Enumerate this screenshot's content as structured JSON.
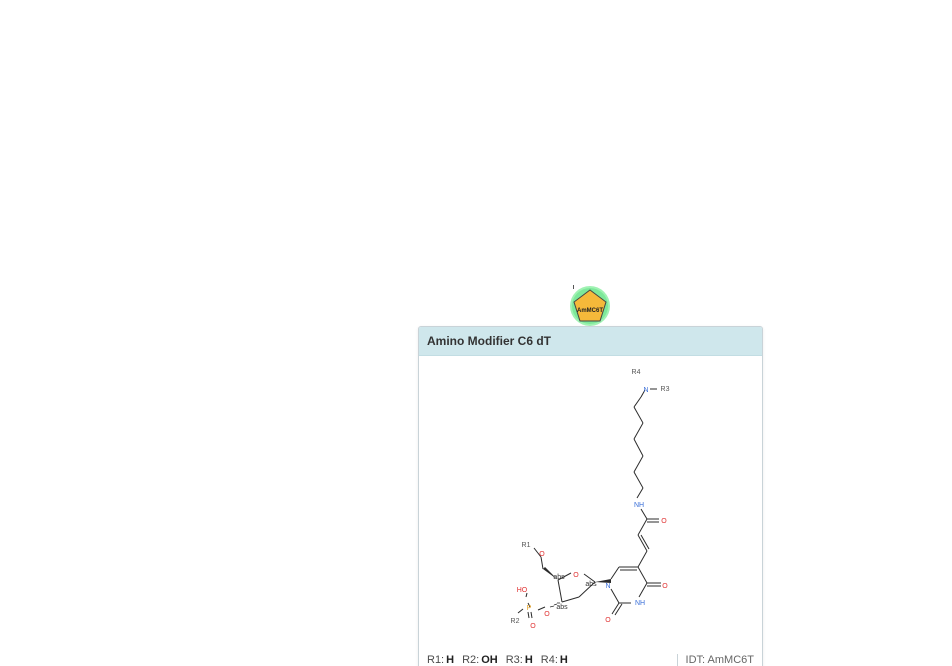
{
  "monomer": {
    "symbol": "AmMC6T",
    "fill_color": "#f5b93a",
    "ring_color": "#6ee68a"
  },
  "tooltip": {
    "title": "Amino Modifier C6 dT",
    "rgroups": [
      {
        "key": "R1:",
        "value": "H"
      },
      {
        "key": "R2:",
        "value": "OH"
      },
      {
        "key": "R3:",
        "value": "H"
      },
      {
        "key": "R4:",
        "value": "H"
      }
    ],
    "idt_label": "IDT:",
    "idt_value": "AmMC6T"
  },
  "structure_labels": {
    "r4": "R4",
    "n_amine": "N",
    "r3": "R3",
    "nh_amide": "NH",
    "o_amide": "O",
    "r1": "R1",
    "o5": "O",
    "o_ring": "O",
    "abs1": "abs",
    "abs2": "abs",
    "abs3": "abs",
    "n1": "N",
    "o4": "O",
    "nh3": "NH",
    "o2": "O",
    "ho": "HO",
    "p": "P",
    "r2": "R2",
    "o3p": "O",
    "op": "O"
  },
  "colors": {
    "header_bg": "#cfe7ec",
    "bond": "#2b2b2b",
    "nitrogen": "#3a6fd8",
    "oxygen": "#e03030",
    "phosphorus": "#e6a020",
    "rgroup": "#555555"
  }
}
